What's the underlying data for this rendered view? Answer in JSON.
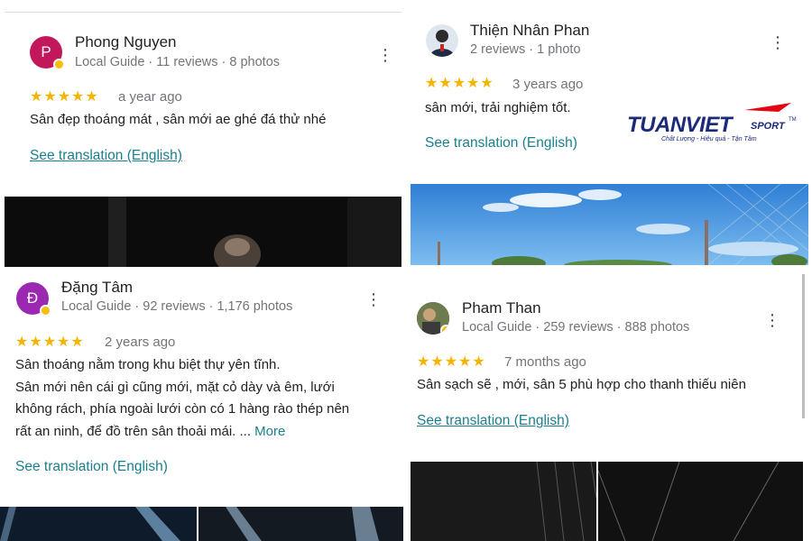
{
  "reviews": [
    {
      "initial": "P",
      "name": "Phong Nguyen",
      "meta": "Local Guide · 11 reviews · 8 photos",
      "stars": "★★★★★",
      "time": "a year ago",
      "text": "Sân đẹp thoáng mát , sân mới ae ghé đá thử nhé",
      "translation": "See translation (English)",
      "avatar_color": "#c2185b"
    },
    {
      "name": "Thiện Nhân Phan",
      "meta": "2 reviews · 1 photo",
      "stars": "★★★★★",
      "time": "3 years ago",
      "text": "sân mới, trải nghiệm tốt.",
      "translation": "See translation (English)"
    },
    {
      "initial": "Đ",
      "name": "Đặng Tâm",
      "meta": "Local Guide · 92 reviews · 1,176 photos",
      "stars": "★★★★★",
      "time": "2 years ago",
      "text_lines": [
        "Sân thoáng nằm trong khu biệt thự yên tĩnh.",
        "Sân mới nên cái gì cũng mới, mặt cỏ dày và êm, lưới",
        "không rách, phía ngoài lưới còn có 1 hàng rào thép nên",
        "rất an ninh, để đồ trên sân thoải mái. ..."
      ],
      "more": "More",
      "translation": "See translation (English)",
      "avatar_color": "#9c27b0"
    },
    {
      "name": "Pham Than",
      "meta": "Local Guide · 259 reviews · 888 photos",
      "stars": "★★★★★",
      "time": "7 months ago",
      "text": "Sân sạch sẽ , mới, sân 5 phù hợp cho thanh thiếu niên",
      "translation": "See translation (English)"
    }
  ],
  "logo": {
    "brand": "TUANVIET",
    "sub": "SPORT",
    "tm": "TM",
    "tagline": "Chất Lượng - Hiệu quả - Tận Tâm",
    "accent": "#e30613",
    "primary": "#1c2a7a"
  },
  "icons": {
    "more": "⋮",
    "more_icon_name": "more-vert-icon"
  }
}
